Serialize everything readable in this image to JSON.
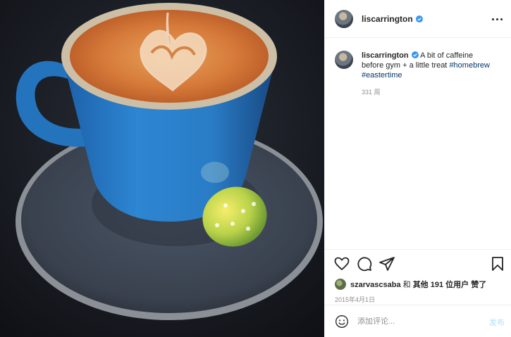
{
  "header": {
    "username": "liscarrington"
  },
  "caption": {
    "username": "liscarrington",
    "text": "A bit of caffeine before gym + a little treat",
    "hashtags": [
      "#homebrew",
      "#eastertime"
    ],
    "time_ago": "331 周"
  },
  "likes": {
    "first_user": "szarvascsaba",
    "connector": "和",
    "others": "其他 191 位用户",
    "suffix": "赞了"
  },
  "date": "2015年4月1日",
  "comment": {
    "placeholder": "添加评论...",
    "post_label": "发布"
  },
  "colors": {
    "verified": "#3897f0",
    "hashtag": "#00376b",
    "post_button_disabled": "#b2dffc"
  },
  "icons": [
    "more-options-icon",
    "heart-icon",
    "comment-icon",
    "share-icon",
    "bookmark-icon",
    "emoji-icon",
    "verified-badge-icon"
  ]
}
